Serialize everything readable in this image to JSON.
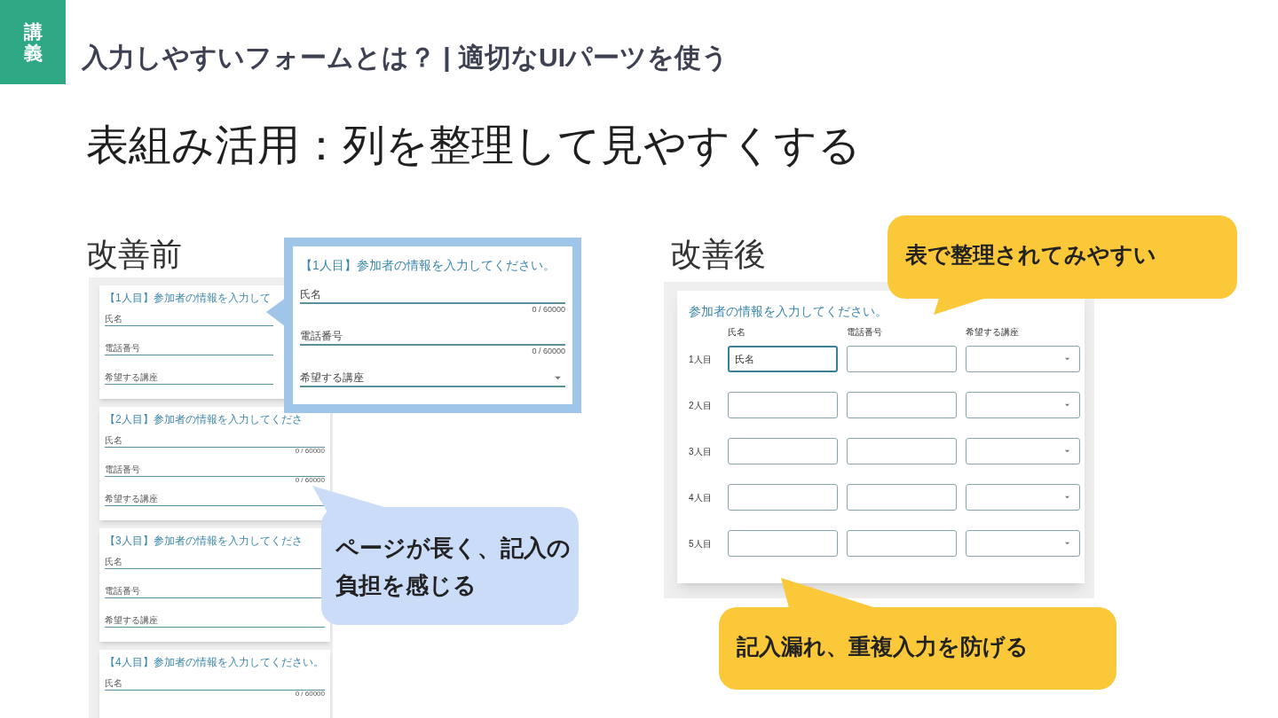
{
  "badge": "講義",
  "header_title": "入力しやすいフォームとは？ | 適切なUIパーツを使う",
  "slide_title": "表組み活用：列を整理して見やすくする",
  "before": {
    "label": "改善前",
    "cards": [
      {
        "title": "【1人目】参加者の情報を入力して",
        "fields": [
          {
            "kind": "text",
            "label": "氏名"
          },
          {
            "kind": "text",
            "label": "電話番号"
          },
          {
            "kind": "text",
            "label": "希望する講座"
          }
        ]
      },
      {
        "title": "【2人目】参加者の情報を入力してくださ",
        "fields": [
          {
            "kind": "text",
            "label": "氏名",
            "counter": "0 / 60000"
          },
          {
            "kind": "text",
            "label": "電話番号",
            "counter": "0 / 60000"
          },
          {
            "kind": "select",
            "label": "希望する講座"
          }
        ]
      },
      {
        "title": "【3人目】参加者の情報を入力してくださ",
        "fields": [
          {
            "kind": "text",
            "label": "氏名"
          },
          {
            "kind": "text",
            "label": "電話番号"
          },
          {
            "kind": "text",
            "label": "希望する講座"
          }
        ]
      },
      {
        "title": "【4人目】参加者の情報を入力してください。",
        "fields": [
          {
            "kind": "text",
            "label": "氏名",
            "counter": "0 / 60000"
          }
        ]
      }
    ],
    "zoom_card": {
      "title": "【1人目】参加者の情報を入力してください。",
      "fields": [
        {
          "kind": "text",
          "label": "氏名",
          "counter": "0 / 60000"
        },
        {
          "kind": "text",
          "label": "電話番号",
          "counter": "0 / 60000"
        },
        {
          "kind": "select",
          "label": "希望する講座"
        }
      ]
    },
    "callout": "ページが長く、記入の負担を感じる"
  },
  "after": {
    "label": "改善後",
    "form_title": "参加者の情報を入力してください。",
    "columns": [
      "氏名",
      "電話番号",
      "希望する講座"
    ],
    "rows": [
      {
        "label": "1人目",
        "name": "氏名",
        "focused": true
      },
      {
        "label": "2人目",
        "focused": false
      },
      {
        "label": "3人目",
        "focused": false
      },
      {
        "label": "4人目",
        "focused": false
      },
      {
        "label": "5人目",
        "focused": false
      }
    ],
    "callouts": [
      "表で整理されてみやすい",
      "記入漏れ、重複入力を防げる"
    ]
  }
}
